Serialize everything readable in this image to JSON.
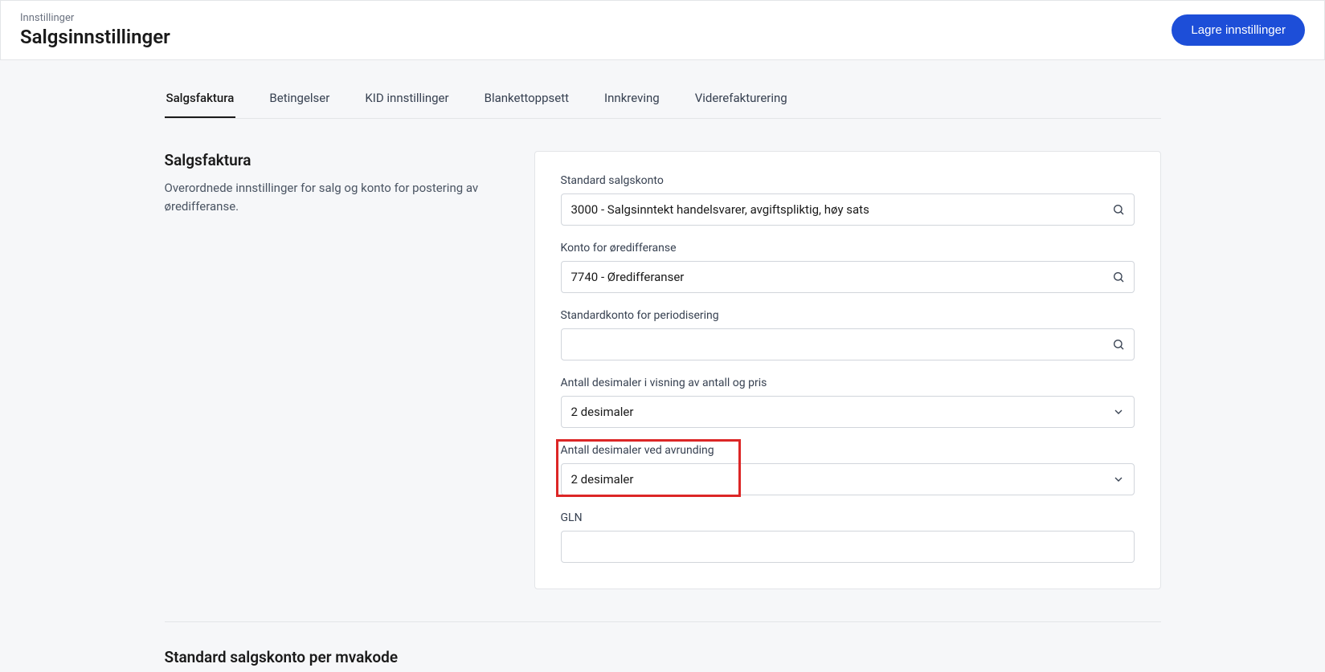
{
  "header": {
    "breadcrumb": "Innstillinger",
    "title": "Salgsinnstillinger",
    "saveButton": "Lagre innstillinger"
  },
  "tabs": [
    {
      "label": "Salgsfaktura",
      "active": true
    },
    {
      "label": "Betingelser",
      "active": false
    },
    {
      "label": "KID innstillinger",
      "active": false
    },
    {
      "label": "Blankettoppsett",
      "active": false
    },
    {
      "label": "Innkreving",
      "active": false
    },
    {
      "label": "Viderefakturering",
      "active": false
    }
  ],
  "section": {
    "title": "Salgsfaktura",
    "description": "Overordnede innstillinger for salg og konto for postering av øredifferanse."
  },
  "form": {
    "standardSalesAccount": {
      "label": "Standard salgskonto",
      "value": "3000 - Salgsinntekt handelsvarer, avgiftspliktig, høy sats"
    },
    "roundingAccount": {
      "label": "Konto for øredifferanse",
      "value": "7740 - Øredifferanser"
    },
    "accrualAccount": {
      "label": "Standardkonto for periodisering",
      "value": ""
    },
    "decimalDisplay": {
      "label": "Antall desimaler i visning av antall og pris",
      "value": "2 desimaler"
    },
    "decimalRounding": {
      "label": "Antall desimaler ved avrunding",
      "value": "2 desimaler"
    },
    "gln": {
      "label": "GLN",
      "value": ""
    }
  },
  "secondarySection": {
    "title": "Standard salgskonto per mvakode"
  }
}
